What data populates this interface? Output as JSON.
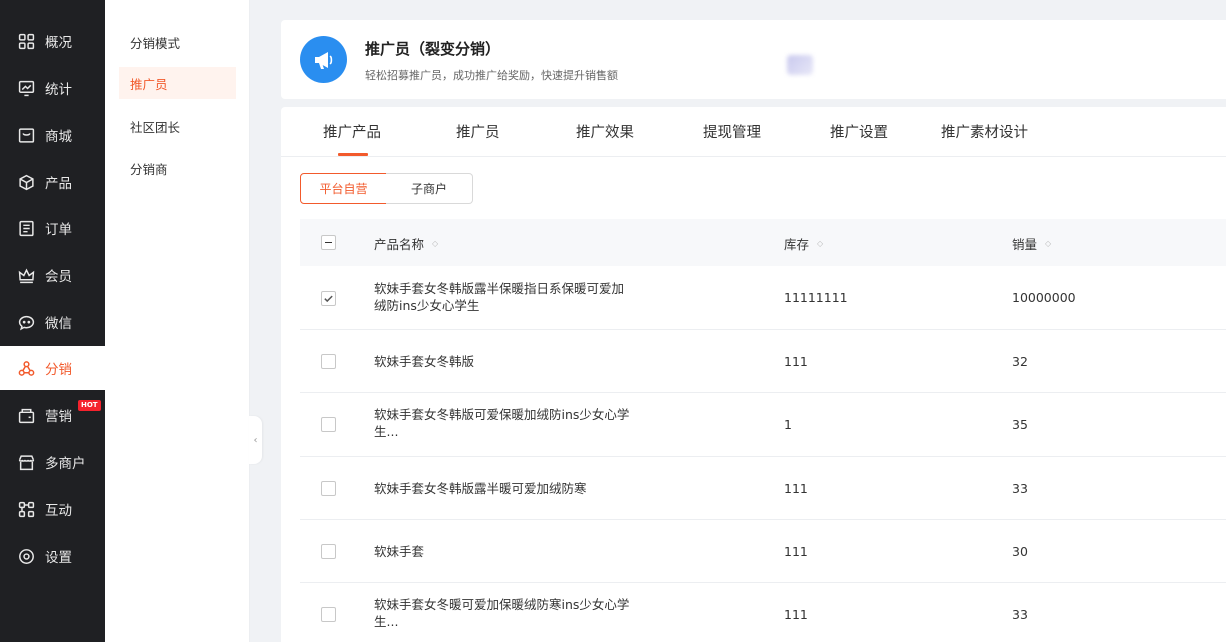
{
  "nav": {
    "items": [
      {
        "label": "概况",
        "icon": "dashboard-icon"
      },
      {
        "label": "统计",
        "icon": "chart-icon"
      },
      {
        "label": "商城",
        "icon": "store-icon"
      },
      {
        "label": "产品",
        "icon": "box-icon"
      },
      {
        "label": "订单",
        "icon": "order-icon"
      },
      {
        "label": "会员",
        "icon": "crown-icon"
      },
      {
        "label": "微信",
        "icon": "wechat-icon"
      },
      {
        "label": "分销",
        "icon": "distribution-icon",
        "active": true
      },
      {
        "label": "营销",
        "icon": "marketing-icon",
        "badge": "HOT"
      },
      {
        "label": "多商户",
        "icon": "multi-merchant-icon"
      },
      {
        "label": "互动",
        "icon": "interaction-icon"
      },
      {
        "label": "设置",
        "icon": "settings-icon"
      }
    ]
  },
  "subnav": {
    "items": [
      {
        "label": "分销模式"
      },
      {
        "label": "推广员",
        "active": true
      },
      {
        "label": "社区团长"
      },
      {
        "label": "分销商"
      }
    ]
  },
  "header": {
    "title": "推广员（裂变分销）",
    "subtitle": "轻松招募推广员，成功推广给奖励，快速提升销售额",
    "logo_icon": "megaphone-icon"
  },
  "tabs": [
    "推广产品",
    "推广员",
    "推广效果",
    "提现管理",
    "推广设置",
    "推广素材设计"
  ],
  "active_tab": 0,
  "segments": {
    "on": "平台自营",
    "off": "子商户"
  },
  "table": {
    "columns": [
      "产品名称",
      "库存",
      "销量"
    ],
    "rows": [
      {
        "name": "软妹手套女冬韩版露半保暖指日系保暖可爱加绒防ins少女心学生",
        "stock": "11111111",
        "sales": "10000000",
        "checked": true
      },
      {
        "name": "软妹手套女冬韩版",
        "stock": "111",
        "sales": "32",
        "checked": false
      },
      {
        "name": "软妹手套女冬韩版可爱保暖加绒防ins少女心学生...",
        "stock": "1",
        "sales": "35",
        "checked": false
      },
      {
        "name": "软妹手套女冬韩版露半暖可爱加绒防寒",
        "stock": "111",
        "sales": "33",
        "checked": false
      },
      {
        "name": "软妹手套",
        "stock": "111",
        "sales": "30",
        "checked": false
      },
      {
        "name": "软妹手套女冬暖可爱加保暖绒防寒ins少女心学生...",
        "stock": "111",
        "sales": "33",
        "checked": false
      }
    ]
  },
  "colors": {
    "accent": "#f25a2c",
    "sidebar_bg": "#1f2023",
    "logo_bg": "#2a8ef0"
  }
}
